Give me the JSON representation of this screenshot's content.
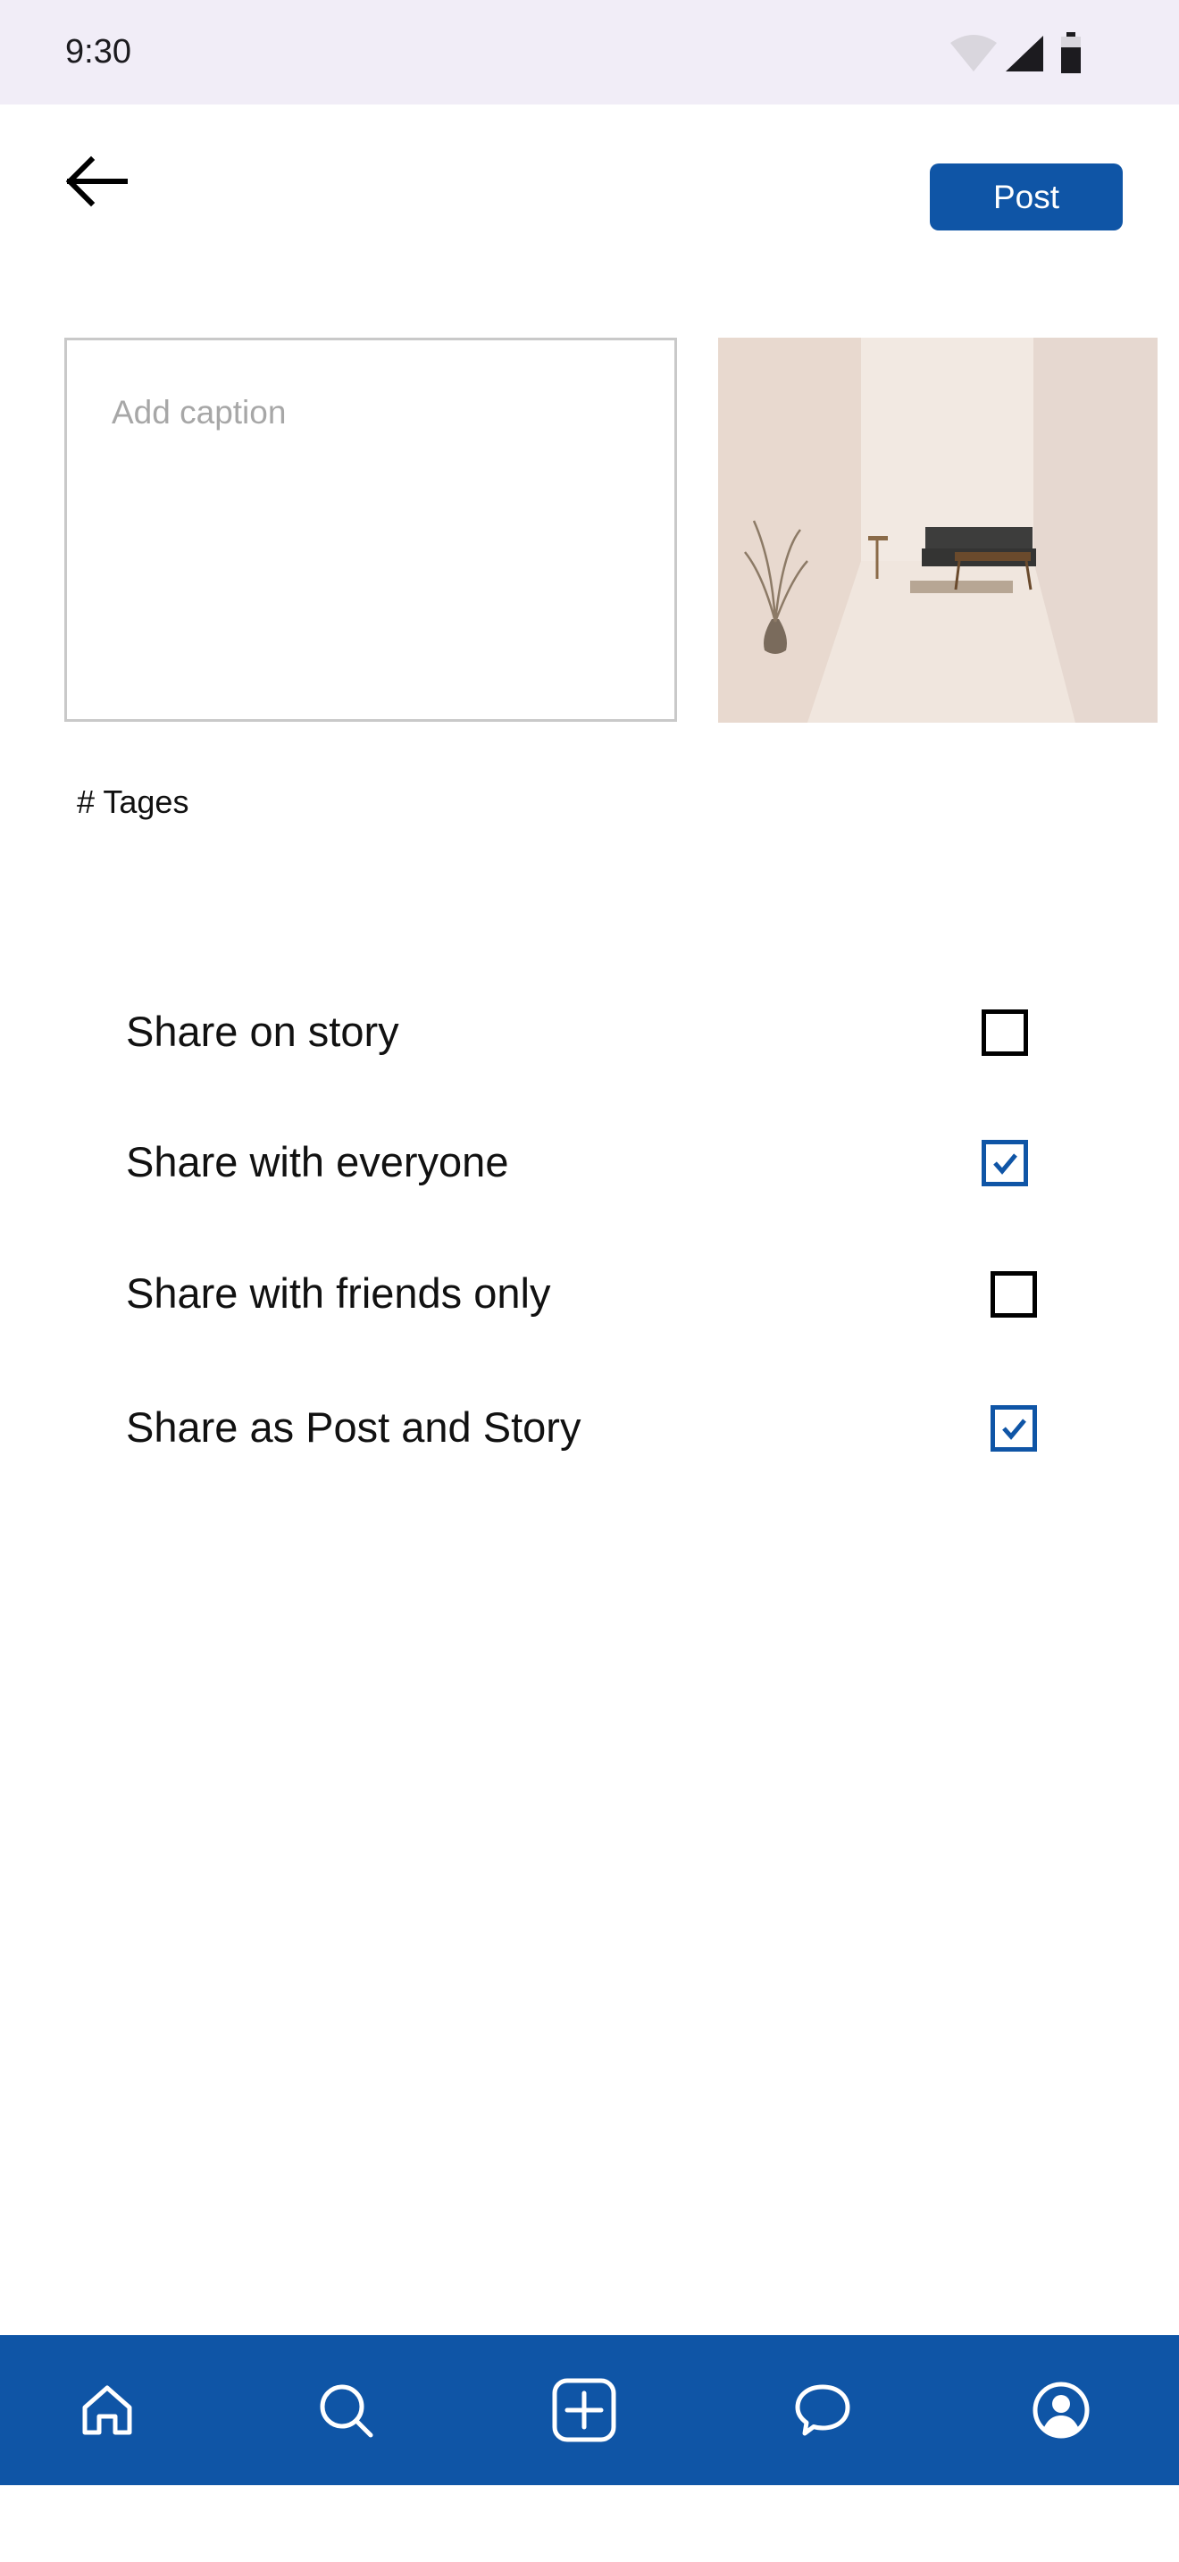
{
  "status_bar": {
    "time": "9:30",
    "icons": [
      "wifi-icon",
      "signal-icon",
      "battery-icon"
    ]
  },
  "header": {
    "back_icon": "arrow-left-icon",
    "post_label": "Post"
  },
  "caption": {
    "placeholder": "Add caption",
    "value": ""
  },
  "tags": {
    "label": "# Tages"
  },
  "options": [
    {
      "label": "Share on story",
      "checked": false
    },
    {
      "label": "Share with everyone",
      "checked": true
    },
    {
      "label": "Share with friends only",
      "checked": false
    },
    {
      "label": "Share as Post and Story",
      "checked": true
    }
  ],
  "bottom_nav": {
    "items": [
      "home-icon",
      "search-icon",
      "add-post-icon",
      "chat-icon",
      "profile-icon"
    ]
  },
  "colors": {
    "primary": "#0f55a6",
    "status_bar_bg": "#f1edf7",
    "placeholder": "#a7a7a7",
    "caption_border": "#c9c9c9"
  }
}
